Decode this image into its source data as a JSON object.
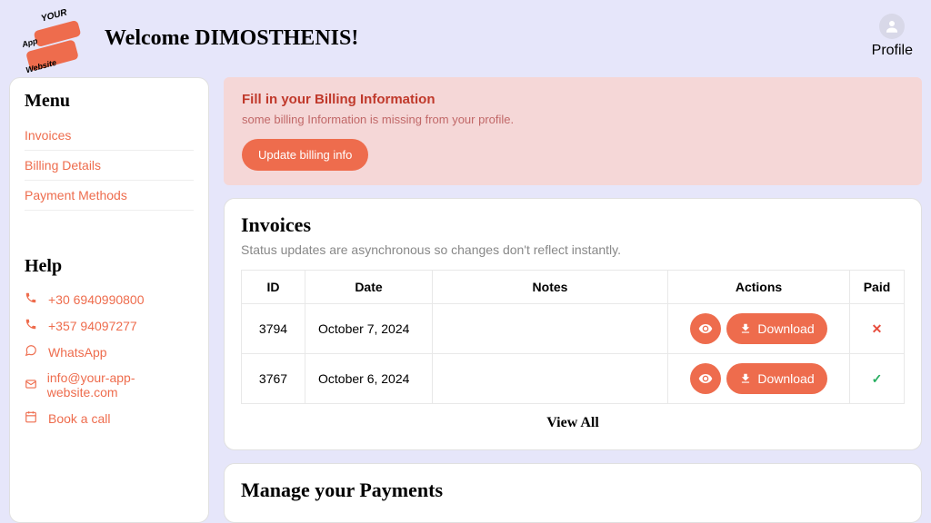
{
  "header": {
    "logo_your": "YOUR",
    "logo_app": "App",
    "logo_website": "Website",
    "welcome": "Welcome DIMOSTHENIS!",
    "profile_label": "Profile"
  },
  "sidebar": {
    "menu_title": "Menu",
    "menu_items": [
      "Invoices",
      "Billing Details",
      "Payment Methods"
    ],
    "help_title": "Help",
    "help_items": [
      {
        "label": "+30 6940990800",
        "icon": "phone"
      },
      {
        "label": "+357 94097277",
        "icon": "phone"
      },
      {
        "label": "WhatsApp",
        "icon": "whatsapp"
      },
      {
        "label": "info@your-app-website.com",
        "icon": "mail"
      },
      {
        "label": "Book a call",
        "icon": "calendar"
      }
    ]
  },
  "alert": {
    "title": "Fill in your Billing Information",
    "text": "some billing Information is missing from your profile.",
    "button": "Update billing info"
  },
  "invoices": {
    "title": "Invoices",
    "subtitle": "Status updates are asynchronous so changes don't reflect instantly.",
    "columns": [
      "ID",
      "Date",
      "Notes",
      "Actions",
      "Paid"
    ],
    "rows": [
      {
        "id": "3794",
        "date": "October 7, 2024",
        "notes": "",
        "paid": false
      },
      {
        "id": "3767",
        "date": "October 6, 2024",
        "notes": "",
        "paid": true
      }
    ],
    "download_label": "Download",
    "view_all": "View All"
  },
  "payments": {
    "title": "Manage your Payments"
  }
}
